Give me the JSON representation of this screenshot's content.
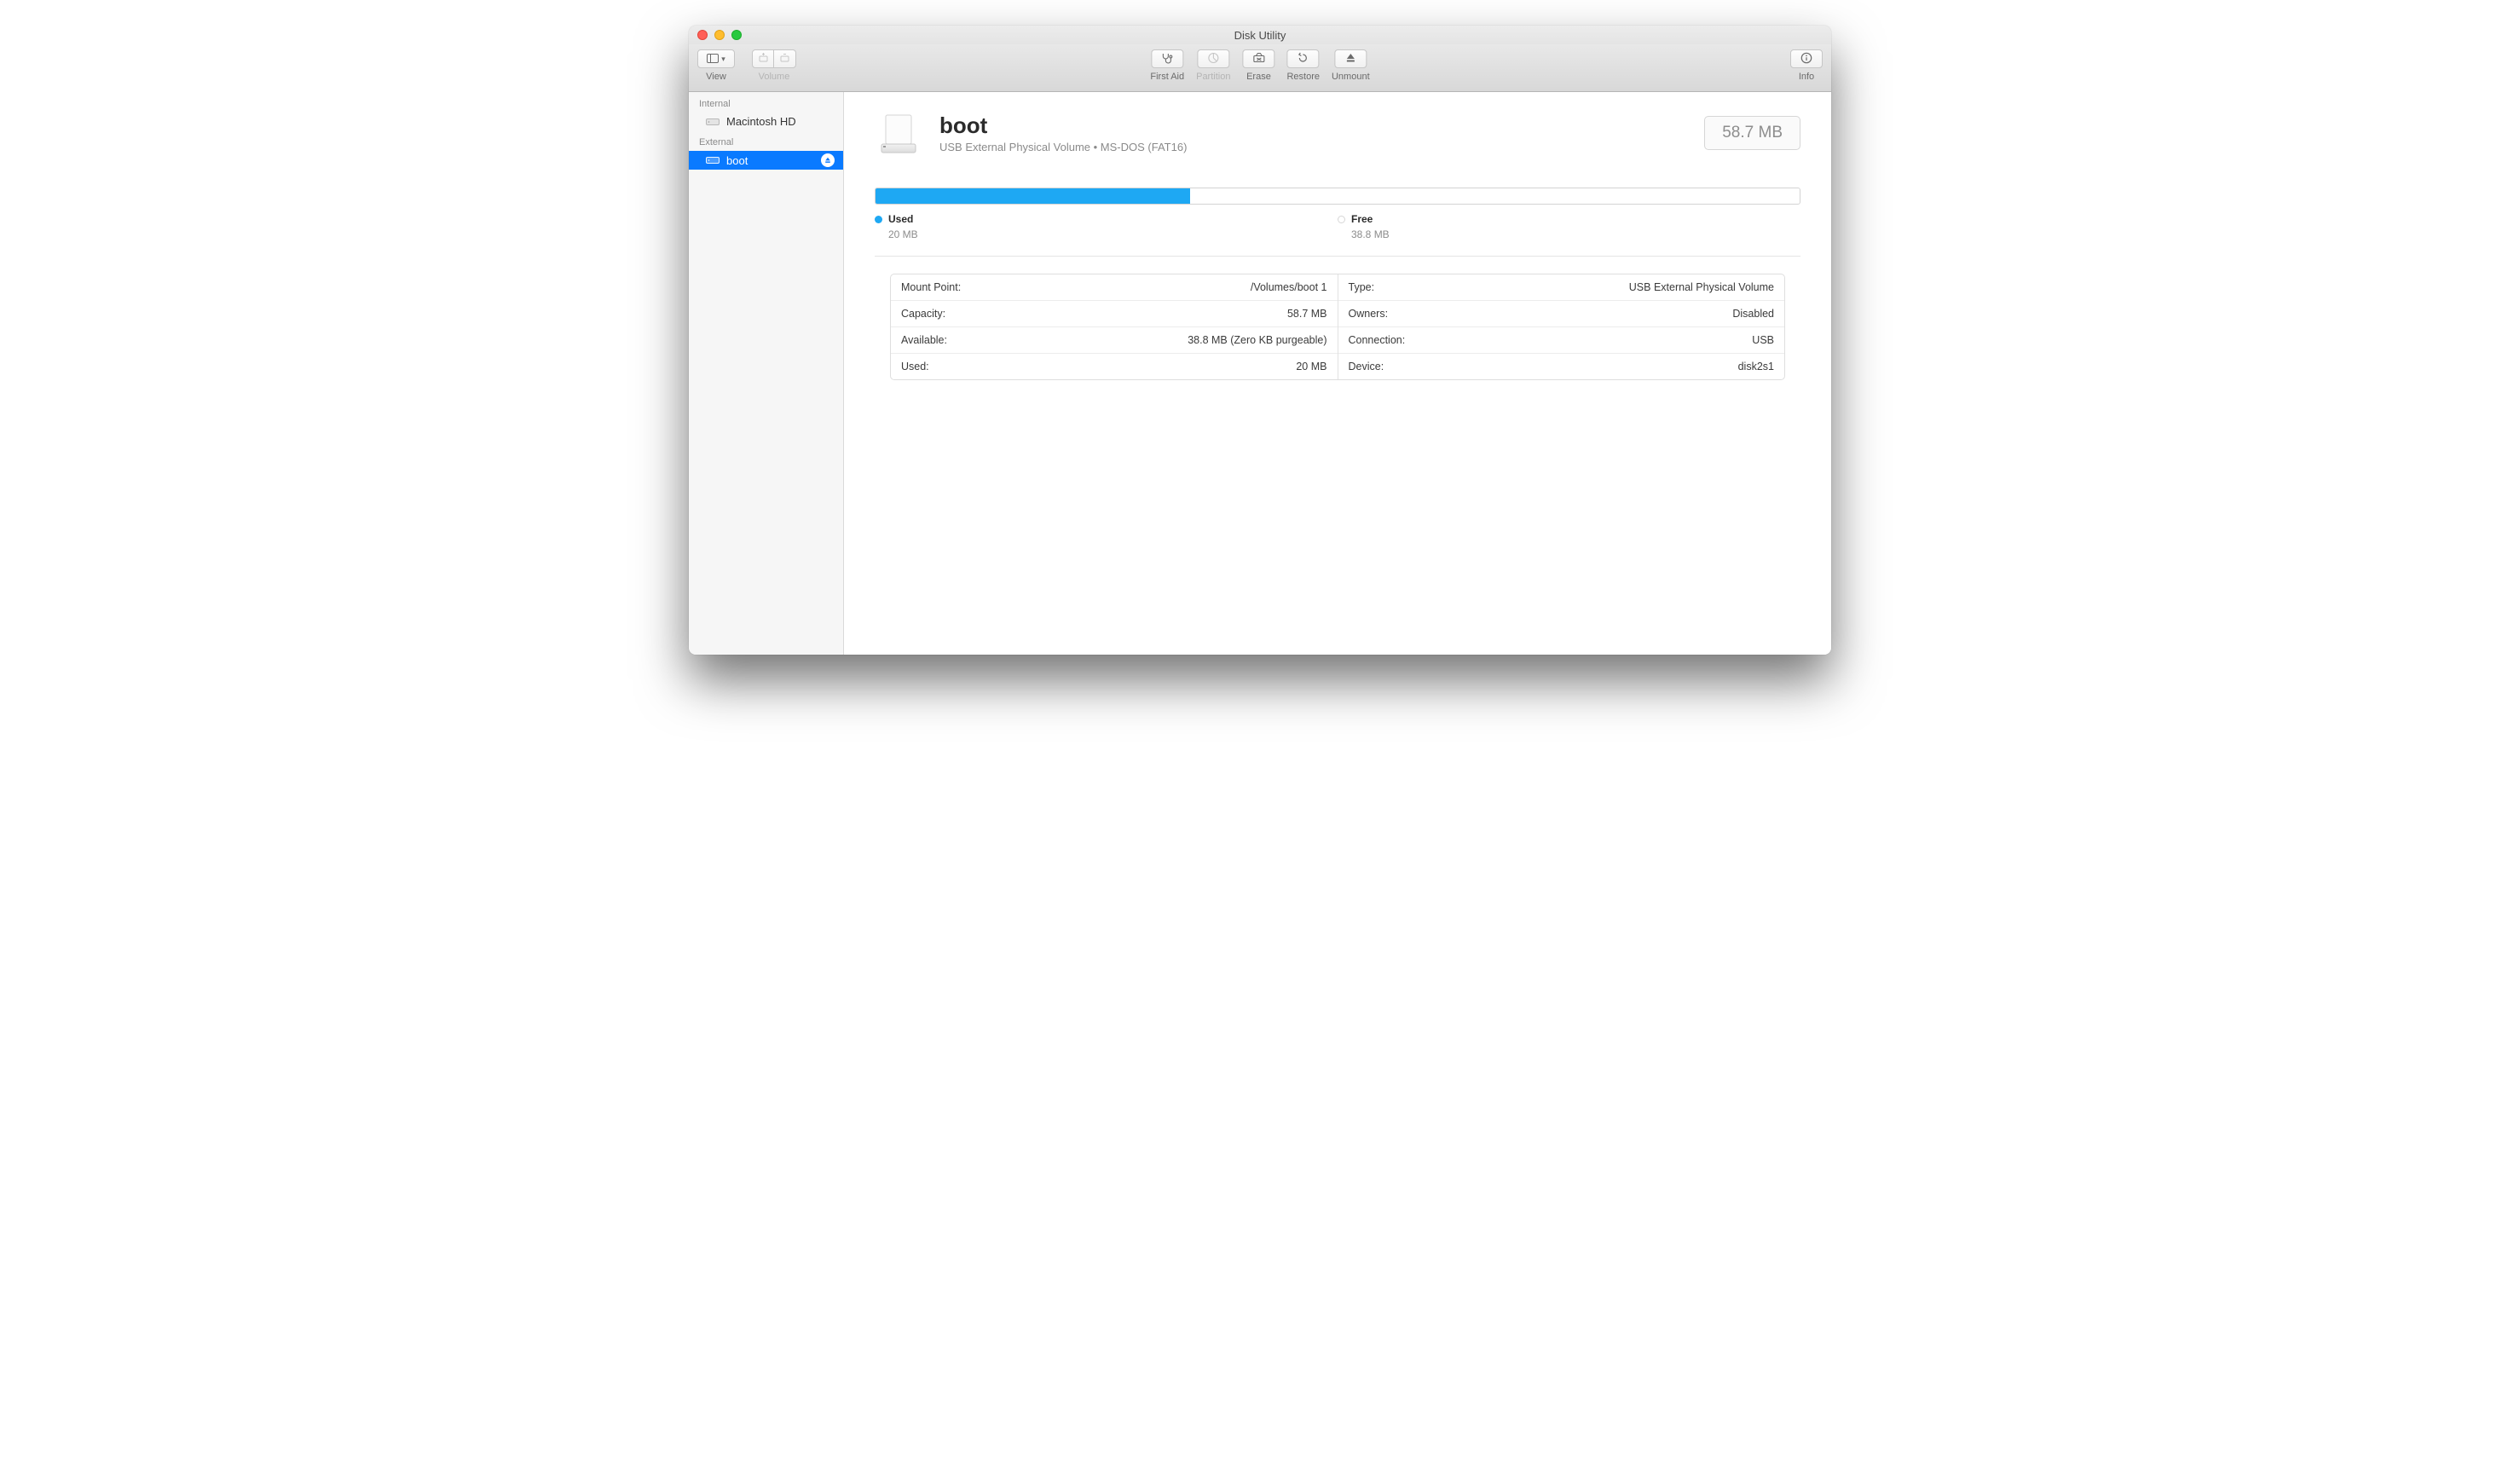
{
  "window": {
    "title": "Disk Utility"
  },
  "toolbar": {
    "view_label": "View",
    "volume_label": "Volume",
    "firstaid_label": "First Aid",
    "partition_label": "Partition",
    "erase_label": "Erase",
    "restore_label": "Restore",
    "unmount_label": "Unmount",
    "info_label": "Info"
  },
  "sidebar": {
    "internal_header": "Internal",
    "external_header": "External",
    "internal": [
      {
        "name": "Macintosh HD"
      }
    ],
    "external": [
      {
        "name": "boot"
      }
    ]
  },
  "volume": {
    "name": "boot",
    "subtitle": "USB External Physical Volume • MS-DOS (FAT16)",
    "size_badge": "58.7 MB"
  },
  "usage": {
    "used_label": "Used",
    "used_value": "20 MB",
    "free_label": "Free",
    "free_value": "38.8 MB",
    "used_pct": 34
  },
  "details": {
    "left": [
      {
        "k": "Mount Point:",
        "v": "/Volumes/boot 1"
      },
      {
        "k": "Capacity:",
        "v": "58.7 MB"
      },
      {
        "k": "Available:",
        "v": "38.8 MB (Zero KB purgeable)"
      },
      {
        "k": "Used:",
        "v": "20 MB"
      }
    ],
    "right": [
      {
        "k": "Type:",
        "v": "USB External Physical Volume"
      },
      {
        "k": "Owners:",
        "v": "Disabled"
      },
      {
        "k": "Connection:",
        "v": "USB"
      },
      {
        "k": "Device:",
        "v": "disk2s1"
      }
    ]
  }
}
